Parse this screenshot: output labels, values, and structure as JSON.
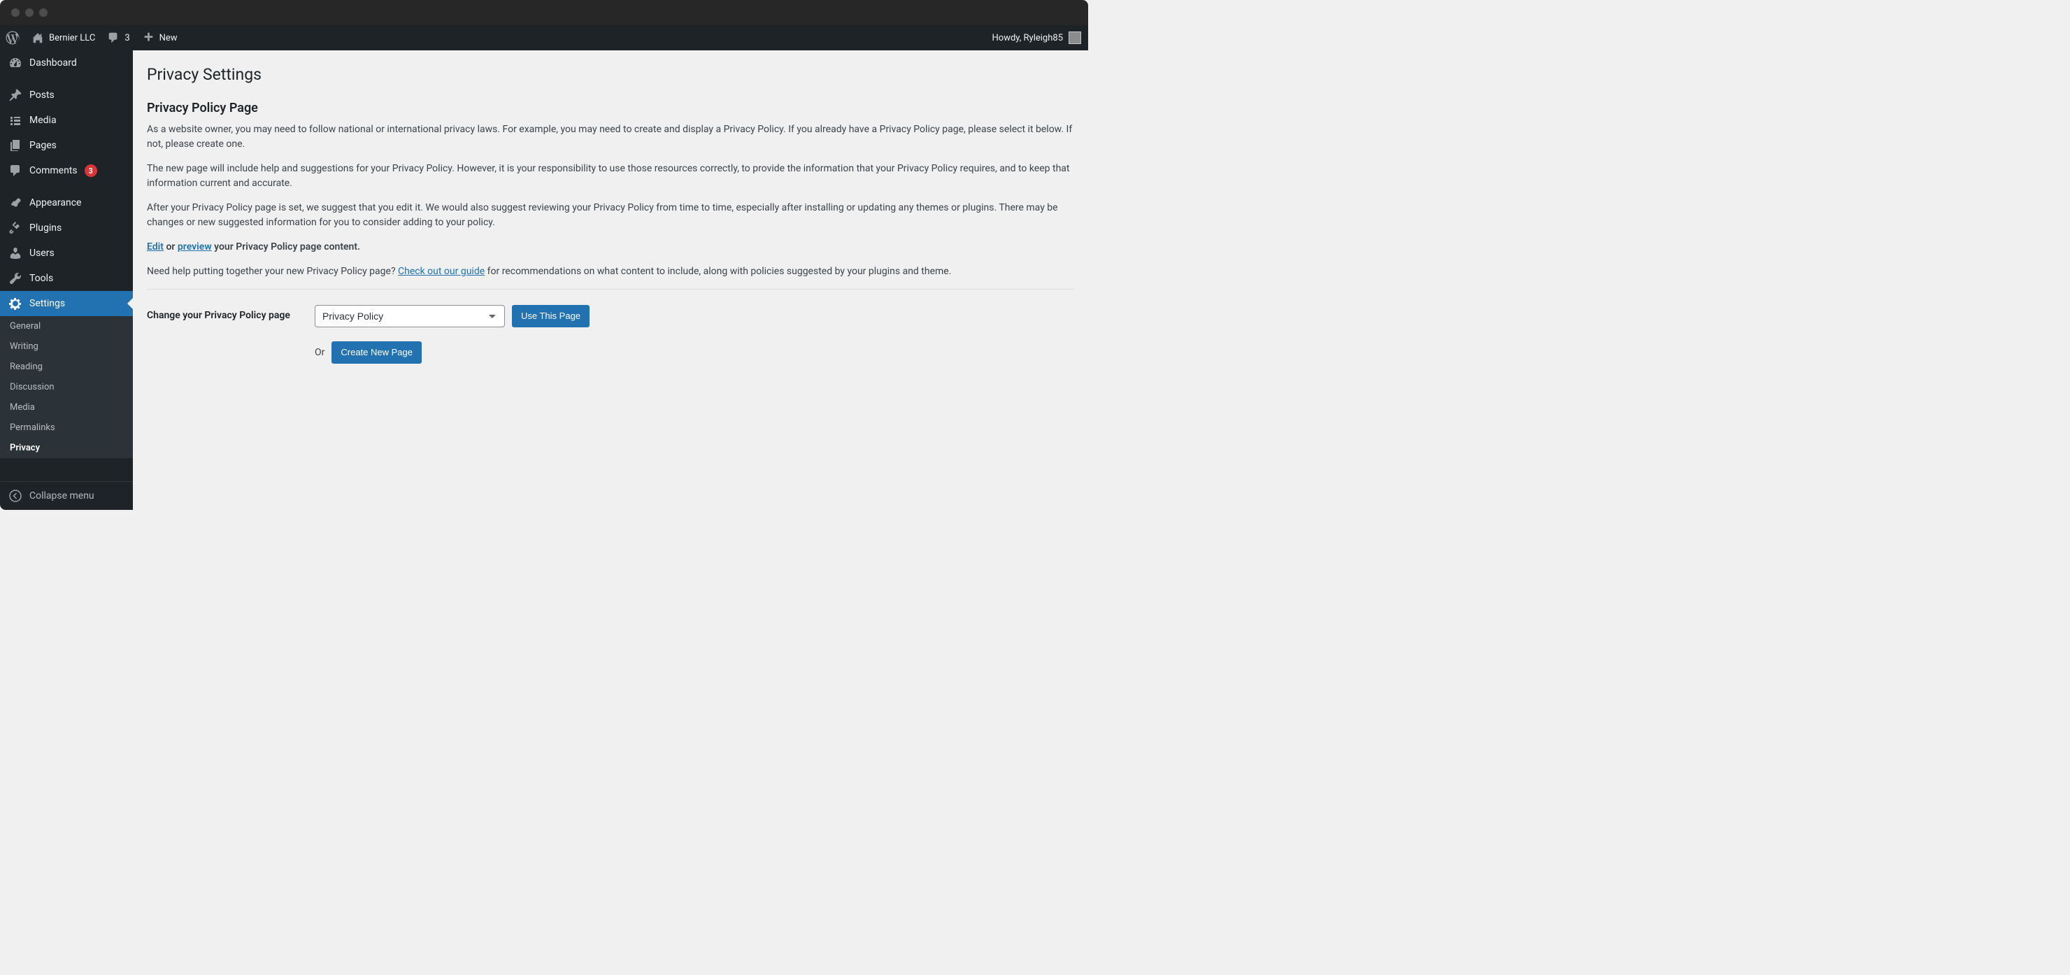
{
  "adminbar": {
    "site_name": "Bernier LLC",
    "comments_count": "3",
    "new_label": "New",
    "howdy_prefix": "Howdy, ",
    "username": "Ryleigh85"
  },
  "sidebar": {
    "dashboard": "Dashboard",
    "posts": "Posts",
    "media": "Media",
    "pages": "Pages",
    "comments": "Comments",
    "comments_badge": "3",
    "appearance": "Appearance",
    "plugins": "Plugins",
    "users": "Users",
    "tools": "Tools",
    "settings": "Settings",
    "submenu": {
      "general": "General",
      "writing": "Writing",
      "reading": "Reading",
      "discussion": "Discussion",
      "media": "Media",
      "permalinks": "Permalinks",
      "privacy": "Privacy"
    },
    "collapse": "Collapse menu"
  },
  "content": {
    "title": "Privacy Settings",
    "subtitle": "Privacy Policy Page",
    "para1": "As a website owner, you may need to follow national or international privacy laws. For example, you may need to create and display a Privacy Policy. If you already have a Privacy Policy page, please select it below. If not, please create one.",
    "para2": "The new page will include help and suggestions for your Privacy Policy. However, it is your responsibility to use those resources correctly, to provide the information that your Privacy Policy requires, and to keep that information current and accurate.",
    "para3": "After your Privacy Policy page is set, we suggest that you edit it. We would also suggest reviewing your Privacy Policy from time to time, especially after installing or updating any themes or plugins. There may be changes or new suggested information for you to consider adding to your policy.",
    "edit_link": "Edit",
    "or_word": " or ",
    "preview_link": "preview",
    "edit_suffix": " your Privacy Policy page content.",
    "help_prefix": "Need help putting together your new Privacy Policy page? ",
    "guide_link": "Check out our guide",
    "help_suffix": " for recommendations on what content to include, along with policies suggested by your plugins and theme.",
    "form": {
      "label": "Change your Privacy Policy page",
      "select_value": "Privacy Policy",
      "use_button": "Use This Page",
      "or": "Or",
      "create_button": "Create New Page"
    }
  }
}
